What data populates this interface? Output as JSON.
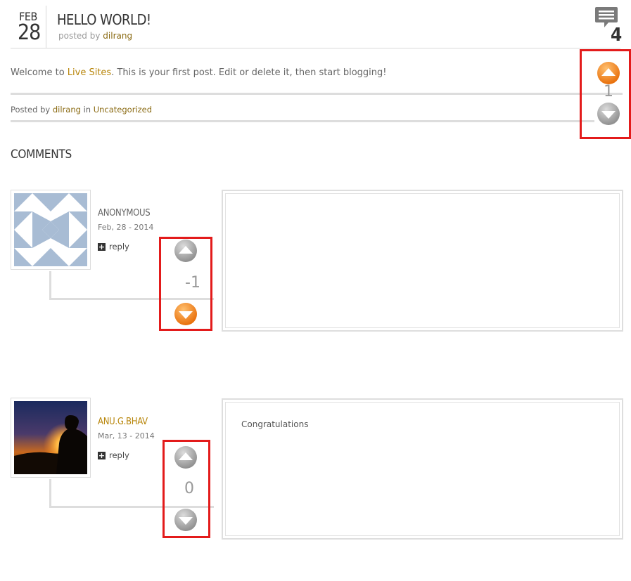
{
  "post": {
    "month": "FEB",
    "day": "28",
    "title": "HELLO WORLD!",
    "byline_prefix": "posted by",
    "author": "dilrang",
    "comment_count": "4",
    "body_prefix": "Welcome to",
    "body_link": "Live Sites",
    "body_suffix": ". This is your first post. Edit or delete it, then start blogging!",
    "meta_prefix": "Posted by",
    "meta_author": "dilrang",
    "meta_in": "in",
    "meta_category": "Uncategorized",
    "vote_score": "1",
    "vote_state": "up"
  },
  "comments_section": {
    "title": "COMMENTS",
    "reply_label": "reply",
    "items": [
      {
        "author": "ANONYMOUS",
        "date": "Feb, 28 - 2014",
        "text": "",
        "vote_score": "-1",
        "vote_state": "down"
      },
      {
        "author": "ANU.G.BHAV",
        "date": "Mar, 13 - 2014",
        "text": "Congratulations",
        "vote_score": "0",
        "vote_state": "none"
      }
    ]
  },
  "colors": {
    "accent_orange": "#f08a1c",
    "vote_gray": "#a8a8a8",
    "highlight_red": "#e31b1b",
    "link_brown": "#8a6a12"
  }
}
